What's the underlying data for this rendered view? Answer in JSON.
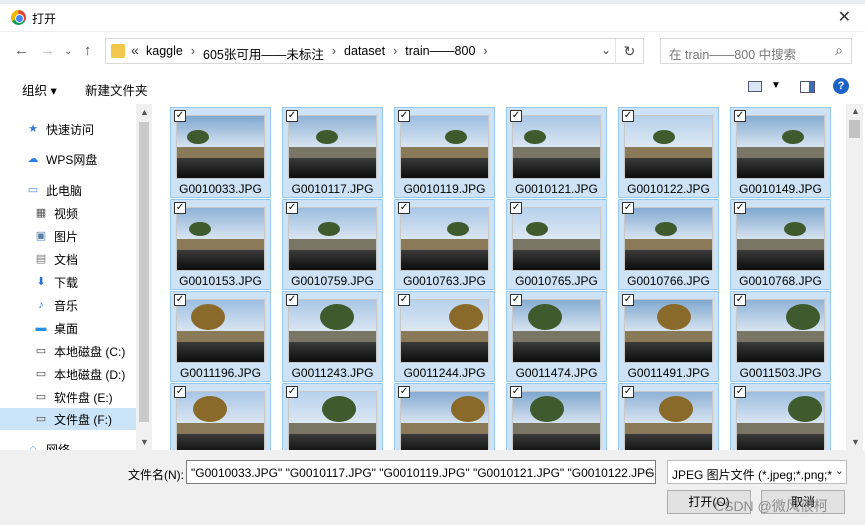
{
  "window": {
    "title": "打开"
  },
  "address": {
    "crumbs": [
      "kaggle",
      "605张可用——未标注",
      "dataset",
      "train——800"
    ]
  },
  "search": {
    "placeholder": "在 train——800 中搜索"
  },
  "toolbar": {
    "organize": "组织 ▾",
    "new_folder": "新建文件夹"
  },
  "sidebar": {
    "items": [
      {
        "label": "快速访问",
        "icon": "star-icon"
      },
      {
        "label": "WPS网盘",
        "icon": "cloud-icon"
      },
      {
        "label": "此电脑",
        "icon": "computer-icon"
      },
      {
        "label": "视频",
        "icon": "video-icon"
      },
      {
        "label": "图片",
        "icon": "pictures-icon"
      },
      {
        "label": "文档",
        "icon": "documents-icon"
      },
      {
        "label": "下载",
        "icon": "download-icon"
      },
      {
        "label": "音乐",
        "icon": "music-icon"
      },
      {
        "label": "桌面",
        "icon": "desktop-icon"
      },
      {
        "label": "本地磁盘 (C:)",
        "icon": "drive-icon"
      },
      {
        "label": "本地磁盘 (D:)",
        "icon": "drive-icon"
      },
      {
        "label": "软件盘 (E:)",
        "icon": "drive-icon"
      },
      {
        "label": "文件盘 (F:)",
        "icon": "drive-icon"
      },
      {
        "label": "网络",
        "icon": "network-icon"
      }
    ]
  },
  "files": [
    "G0010033.JPG",
    "G0010117.JPG",
    "G0010119.JPG",
    "G0010121.JPG",
    "G0010122.JPG",
    "G0010149.JPG",
    "G0010153.JPG",
    "G0010759.JPG",
    "G0010763.JPG",
    "G0010765.JPG",
    "G0010766.JPG",
    "G0010768.JPG",
    "G0011196.JPG",
    "G0011243.JPG",
    "G0011244.JPG",
    "G0011474.JPG",
    "G0011491.JPG",
    "G0011503.JPG",
    "",
    "",
    "",
    "",
    "",
    ""
  ],
  "bottom": {
    "filename_label": "文件名(N):",
    "filename_value": "\"G0010033.JPG\" \"G0010117.JPG\" \"G0010119.JPG\" \"G0010121.JPG\" \"G0010122.JPG",
    "filetype": "JPEG 图片文件 (*.jpeg;*.png;*",
    "open": "打开(O)",
    "cancel": "取消"
  },
  "watermark": "CSDN @微风很柯"
}
